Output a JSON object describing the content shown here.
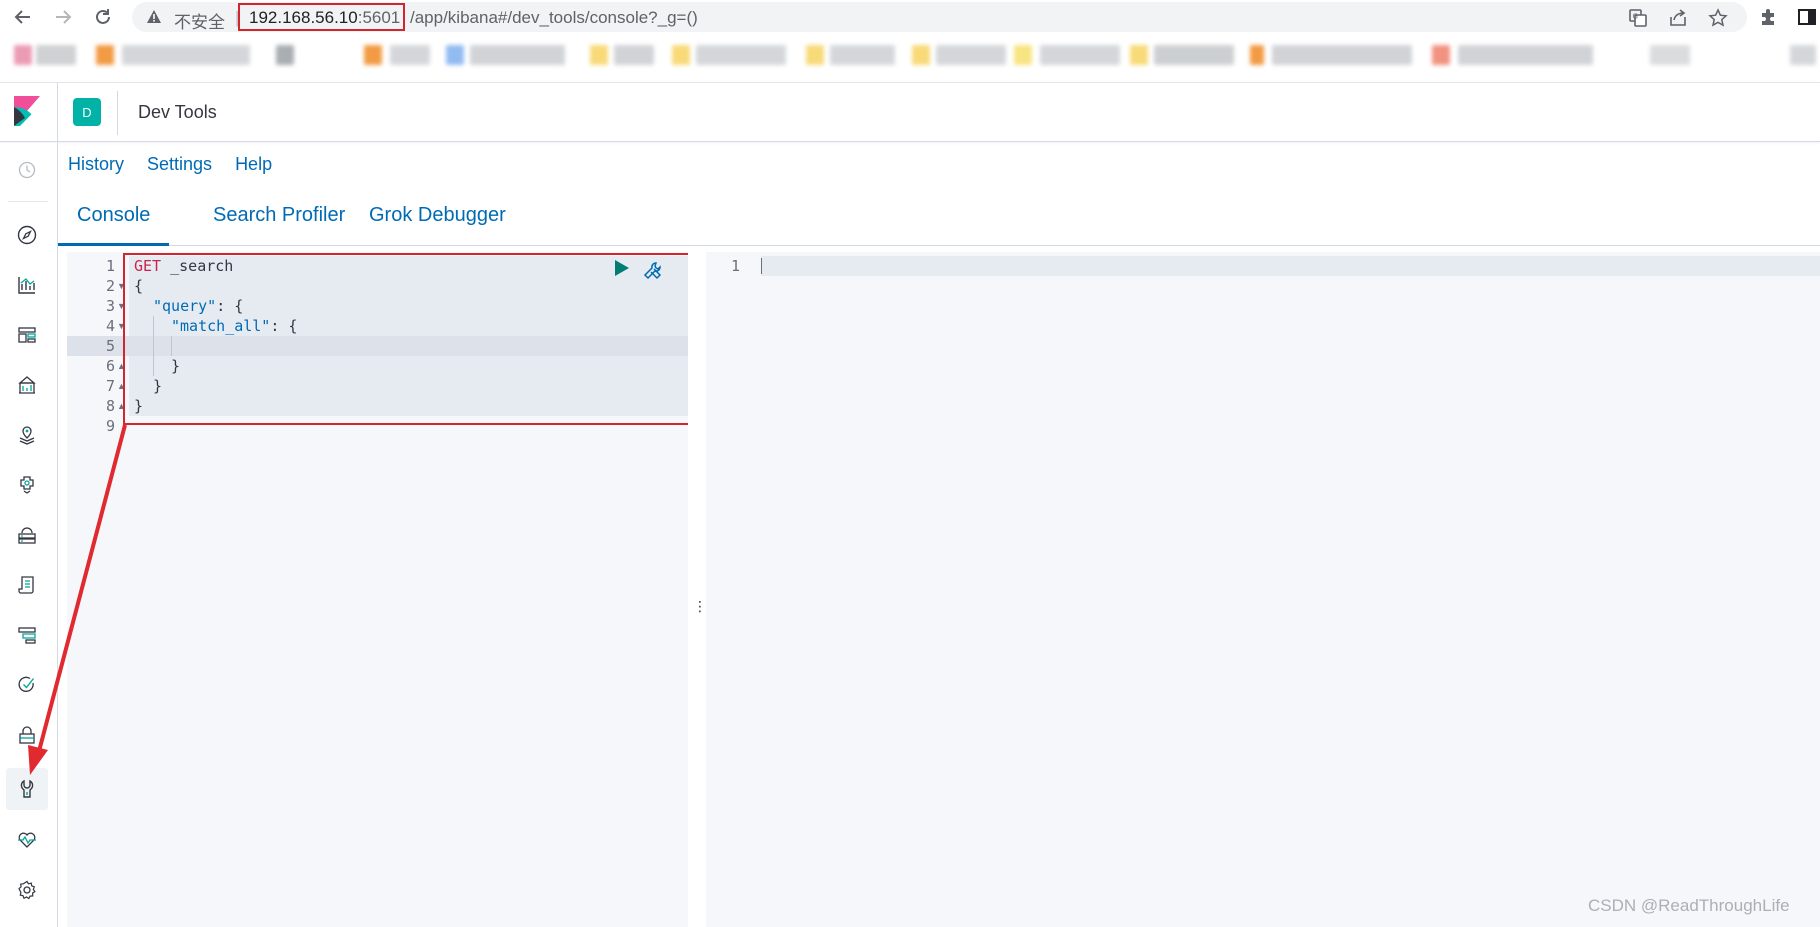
{
  "browser": {
    "insecure_label": "不安全",
    "separator": "|",
    "url_host": "192.168.56.10",
    "url_port": ":5601",
    "url_path": "/app/kibana#/dev_tools/console?_g=()"
  },
  "header": {
    "space_initial": "D",
    "title": "Dev Tools"
  },
  "menu": {
    "history": "History",
    "settings": "Settings",
    "help": "Help"
  },
  "tabs": [
    {
      "label": "Console",
      "active": true
    },
    {
      "label": "Search Profiler",
      "active": false
    },
    {
      "label": "Grok Debugger",
      "active": false
    }
  ],
  "editor": {
    "line_numbers": [
      "1",
      "2",
      "3",
      "4",
      "5",
      "6",
      "7",
      "8",
      "9"
    ],
    "method": "GET",
    "endpoint": "_search",
    "l2": "{",
    "l3_key": "\"query\"",
    "l3_rest": ": {",
    "l4_key": "\"match_all\"",
    "l4_rest": ": {",
    "l6": "}",
    "l7": "}",
    "l8": "}"
  },
  "output": {
    "line_numbers": [
      "1"
    ]
  },
  "resizer_glyph": "⋮",
  "watermark": "CSDN @ReadThroughLife",
  "colors": {
    "accent": "#006bb4",
    "space_avatar": "#01b2a7",
    "annotation_red": "#d4252e",
    "run_button": "#017d73"
  }
}
